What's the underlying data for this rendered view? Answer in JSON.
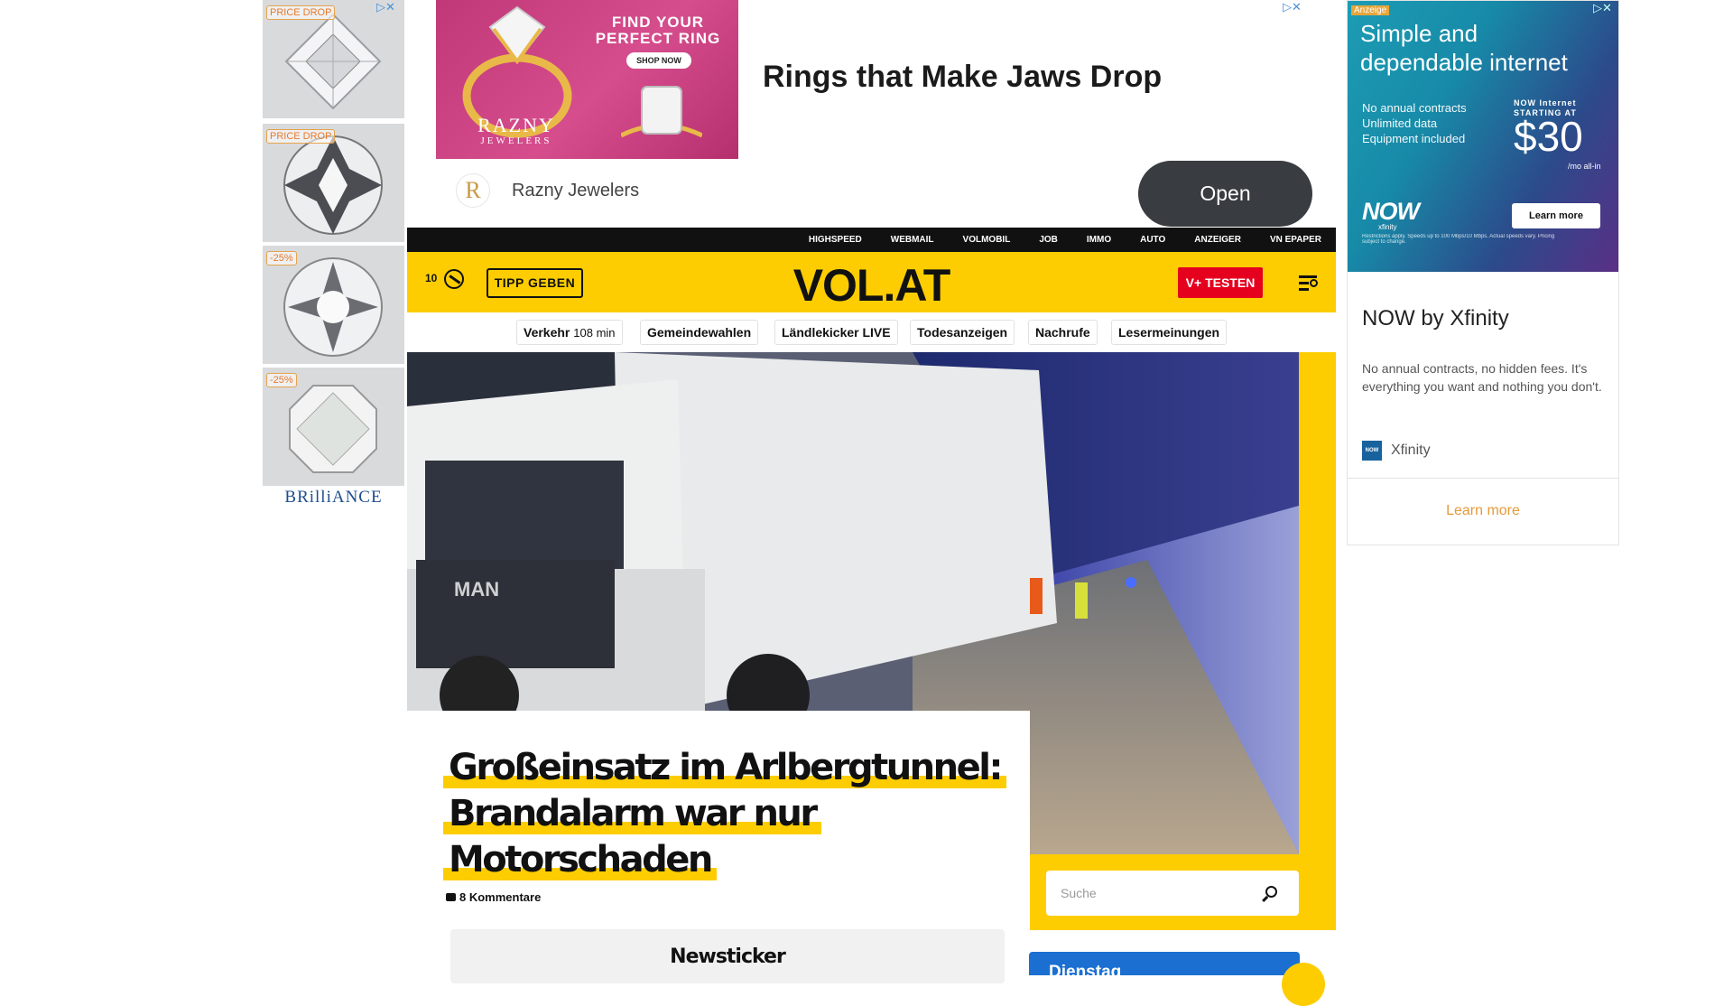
{
  "left_ad": {
    "gems": [
      {
        "tag": "PRICE DROP"
      },
      {
        "tag": "PRICE DROP"
      },
      {
        "tag": "-25%"
      },
      {
        "tag": "-25%"
      }
    ],
    "brand": "BRilliANCE"
  },
  "top_ad": {
    "image_headline": "FIND YOUR PERFECT RING",
    "image_button": "SHOP NOW",
    "image_brand": "RAZNY",
    "image_brand_sub": "JEWELERS",
    "headline": "Rings that Make Jaws Drop",
    "advertiser_logo": "R",
    "advertiser": "Razny Jewelers",
    "cta": "Open"
  },
  "right_ad": {
    "badge": "Anzeige",
    "image_headline": "Simple and dependable internet",
    "features": [
      "No annual contracts",
      "Unlimited data",
      "Equipment included"
    ],
    "starting": "NOW Internet STARTING AT",
    "price": "$30",
    "price_unit": "/mo all-in",
    "logo_text": "NOW",
    "logo_sub": "xfinity",
    "image_cta": "Learn more",
    "fine_print": "Restrictions apply. Speeds up to 100 Mbps/10 Mbps. Actual speeds vary. Pricing subject to change.",
    "title": "NOW by Xfinity",
    "description": "No annual contracts, no hidden fees. It's everything you want and nothing you don't.",
    "brand_icon": "NOW",
    "brand": "Xfinity",
    "cta": "Learn more"
  },
  "site": {
    "top_links": [
      "HIGHSPEED",
      "WEBMAIL",
      "VOLMOBIL",
      "JOB",
      "IMMO",
      "AUTO",
      "ANZEIGER",
      "VN EPAPER"
    ],
    "weather_temp": "10",
    "tipp_button": "TIPP GEBEN",
    "logo": "VOL.AT",
    "vplus_button": "V+ TESTEN",
    "subnav": [
      {
        "label": "Verkehr",
        "sub": "108 min"
      },
      {
        "label": "Gemeindewahlen",
        "sub": ""
      },
      {
        "label": "Ländlekicker LIVE",
        "sub": ""
      },
      {
        "label": "Todesanzeigen",
        "sub": ""
      },
      {
        "label": "Nachrufe",
        "sub": ""
      },
      {
        "label": "Lesermeinungen",
        "sub": ""
      }
    ],
    "hero": {
      "truck_brand": "MAN"
    },
    "article": {
      "headline_lines": [
        "Großeinsatz im Arlbergtunnel:",
        "Brandalarm war nur",
        "Motorschaden"
      ],
      "comments": "8 Kommentare"
    },
    "newsticker": "Newsticker",
    "search": {
      "placeholder": "Suche"
    },
    "day_card": "Dienstag"
  },
  "colors": {
    "brand_yellow": "#fdcd01",
    "vplus_red": "#e5001e",
    "day_card_blue": "#1b6fd1",
    "ad_cta_orange": "#e59a3a"
  }
}
